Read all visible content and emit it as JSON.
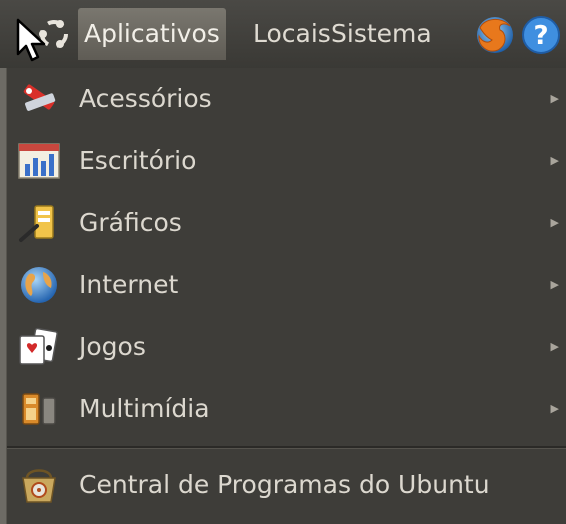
{
  "panel": {
    "menus": [
      {
        "label": "Aplicativos",
        "active": true
      },
      {
        "label": "Locais"
      },
      {
        "label": "Sistema"
      }
    ],
    "icons": [
      "ubuntu-logo-icon",
      "firefox-icon",
      "help-icon"
    ],
    "help_glyph": "?"
  },
  "menu": {
    "items": [
      {
        "label": "Acessórios",
        "icon": "accessories-icon",
        "has_submenu": true
      },
      {
        "label": "Escritório",
        "icon": "office-icon",
        "has_submenu": true
      },
      {
        "label": "Gráficos",
        "icon": "graphics-icon",
        "has_submenu": true
      },
      {
        "label": "Internet",
        "icon": "internet-icon",
        "has_submenu": true
      },
      {
        "label": "Jogos",
        "icon": "games-icon",
        "has_submenu": true
      },
      {
        "label": "Multimídia",
        "icon": "multimedia-icon",
        "has_submenu": true
      },
      {
        "label": "Central de Programas do Ubuntu",
        "icon": "software-center-icon",
        "has_submenu": false
      }
    ],
    "arrow_glyph": "▶"
  },
  "colors": {
    "panel_bg": "#3c3b37",
    "active_bg": "#6e6b64",
    "text": "#dcd8cf"
  }
}
